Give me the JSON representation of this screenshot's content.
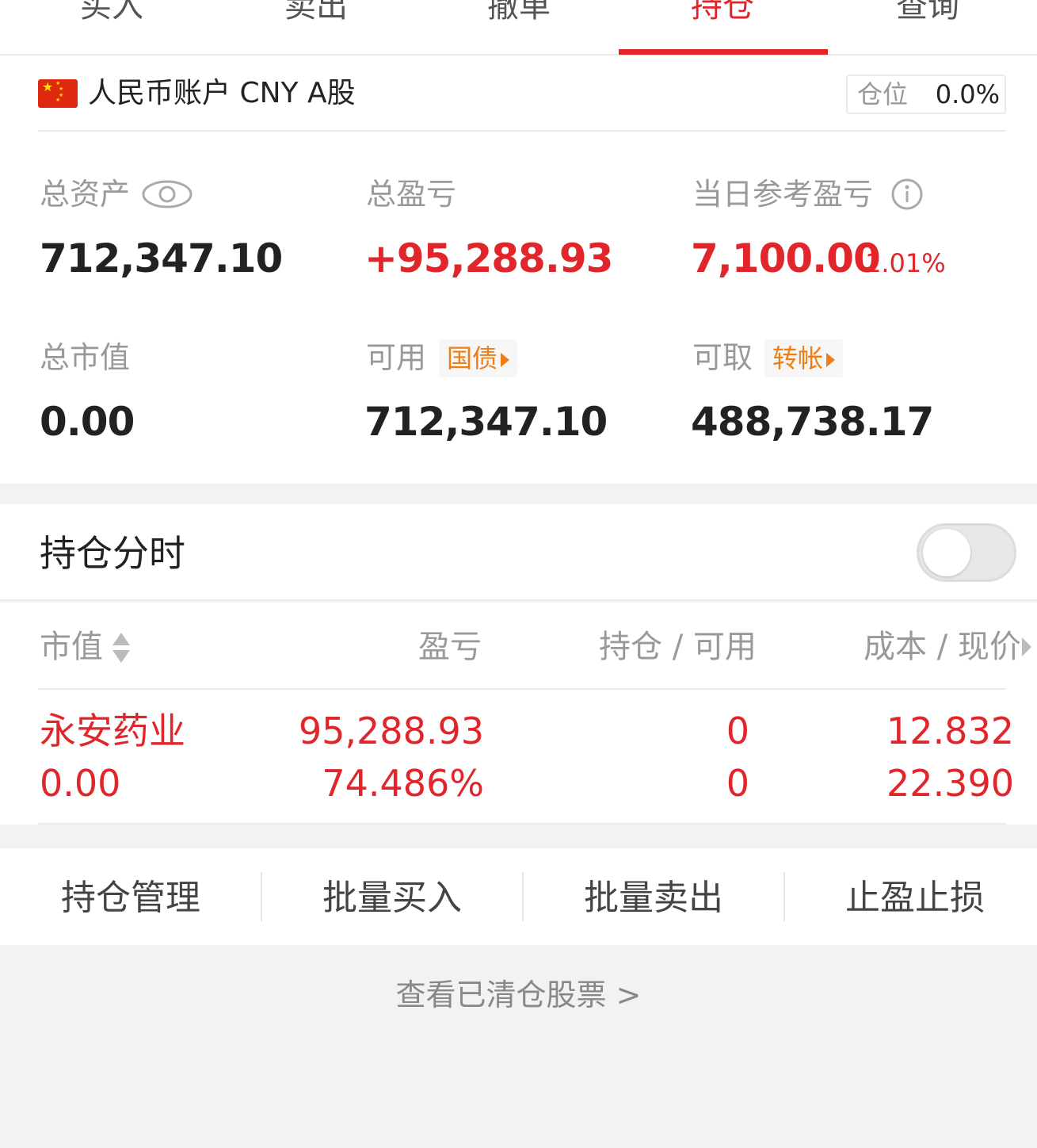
{
  "tabs": [
    {
      "label": "买入"
    },
    {
      "label": "卖出"
    },
    {
      "label": "撤单"
    },
    {
      "label": "持仓"
    },
    {
      "label": "查询"
    }
  ],
  "account": {
    "name": "人民币账户 CNY A股",
    "position_label": "仓位",
    "position_value": "0.0%",
    "total_assets_label": "总资产",
    "total_assets": "712,347.10",
    "total_pnl_label": "总盈亏",
    "total_pnl": "+95,288.93",
    "daily_pnl_label": "当日参考盈亏",
    "daily_pnl": "7,100.00",
    "daily_pnl_pct": "1.01%",
    "market_value_label": "总市值",
    "market_value": "0.00",
    "available_label": "可用",
    "available_tag": "国债",
    "available": "712,347.10",
    "withdrawable_label": "可取",
    "withdrawable_tag": "转帐",
    "withdrawable": "488,738.17"
  },
  "intraday": {
    "title": "持仓分时",
    "enabled": false
  },
  "table": {
    "headers": {
      "market_value": "市值",
      "pnl": "盈亏",
      "holding": "持仓 / 可用",
      "cost": "成本 / 现价"
    },
    "rows": [
      {
        "name": "永安药业",
        "market_value": "0.00",
        "pnl": "95,288.93",
        "pnl_pct": "74.486%",
        "holding": "0",
        "available": "0",
        "cost": "12.832",
        "price": "22.390"
      }
    ]
  },
  "actions": [
    {
      "label": "持仓管理"
    },
    {
      "label": "批量买入"
    },
    {
      "label": "批量卖出"
    },
    {
      "label": "止盈止损"
    }
  ],
  "footer": {
    "cleared_link": "查看已清仓股票 >"
  },
  "colors": {
    "accent_red": "#e0262b",
    "tag_orange": "#f07d12"
  }
}
